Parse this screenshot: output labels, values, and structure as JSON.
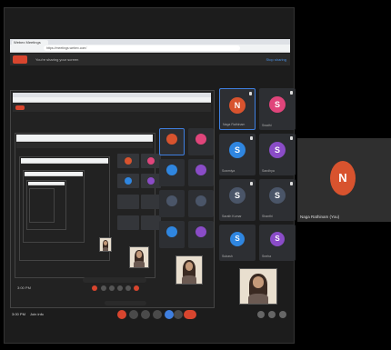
{
  "browser": {
    "tab_title": "Webex Meetings",
    "url": "https://meetings.webex.com/"
  },
  "meeting": {
    "title": "You're sharing your screen",
    "header_link": "Stop sharing"
  },
  "participants": [
    {
      "initial": "N",
      "name": "Naga Rathinam",
      "color": "#d8532e",
      "active": true
    },
    {
      "initial": "S",
      "name": "Swathi",
      "color": "#e0457b",
      "active": false
    },
    {
      "initial": "S",
      "name": "Sowmiya",
      "color": "#2f86e0",
      "active": false
    },
    {
      "initial": "S",
      "name": "Sandhya",
      "color": "#8a4cc7",
      "active": false
    },
    {
      "initial": "S",
      "name": "Sarath Kumar",
      "color": "#4a5568",
      "active": false
    },
    {
      "initial": "S",
      "name": "Shanthi",
      "color": "#4a5568",
      "active": false
    },
    {
      "initial": "S",
      "name": "Subash",
      "color": "#2f86e0",
      "active": false
    },
    {
      "initial": "S",
      "name": "Sneha",
      "color": "#8a4cc7",
      "active": false
    }
  ],
  "footer": {
    "time": "3:00 PM",
    "meeting_id": "Join info"
  },
  "self_view": {
    "initial": "N",
    "name": "Naga Rathinam (You)",
    "color": "#d8532e"
  }
}
